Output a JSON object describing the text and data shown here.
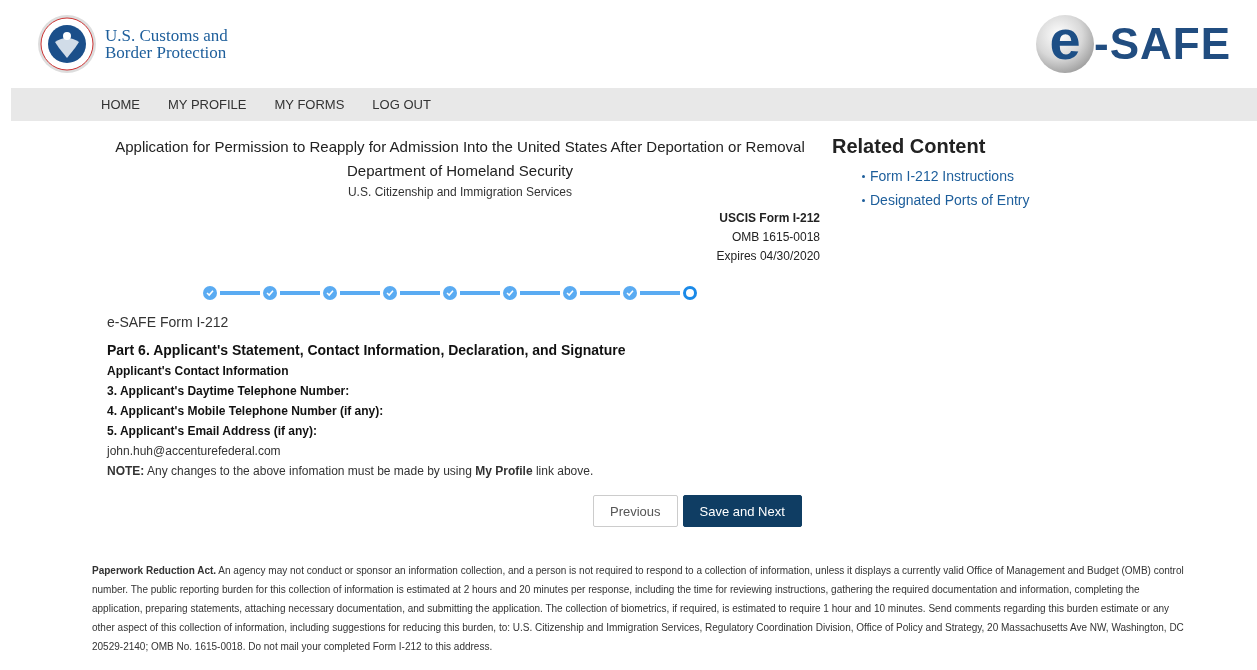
{
  "header": {
    "agency_name": [
      "U.S. Customs and",
      "Border Protection"
    ],
    "brand_logo": {
      "mark": "e",
      "text": "-SAFE"
    }
  },
  "nav": {
    "items": [
      "HOME",
      "MY PROFILE",
      "MY FORMS",
      "LOG OUT"
    ]
  },
  "form_header": {
    "title": "Application for Permission to Reapply for Admission Into the United States After Deportation or Removal",
    "department": "Department of Homeland Security",
    "agency": "U.S. Citizenship and Immigration Services",
    "form_number": "USCIS Form I-212",
    "omb": "OMB 1615-0018",
    "expires": "Expires 04/30/2020"
  },
  "stepper": [
    {
      "completed": true
    },
    {
      "completed": true
    },
    {
      "completed": true
    },
    {
      "completed": true
    },
    {
      "completed": true
    },
    {
      "completed": true
    },
    {
      "completed": true
    },
    {
      "completed": true
    },
    {
      "completed": false
    }
  ],
  "form_label": "e-SAFE Form I-212",
  "section": {
    "title": "Part 6. Applicant's Statement, Contact Information, Declaration, and Signature",
    "subtitle": "Applicant's Contact Information",
    "fields": [
      {
        "label": "3. Applicant's Daytime Telephone Number:"
      },
      {
        "label": "4. Applicant's Mobile Telephone Number (if any):"
      },
      {
        "label": "5. Applicant's Email Address (if any):",
        "value": "john.huh@accenturefederal.com"
      }
    ],
    "note": "**NOTE:** Any changes to the above infomation must be made by using **My Profile** link above."
  },
  "buttons": [
    "Previous",
    "Save and Next"
  ],
  "related_content": {
    "title": "Related Content",
    "links": [
      "Form I-212 Instructions",
      "Designated Ports of Entry"
    ]
  },
  "footer": "**Paperwork Reduction Act.**  An agency may not conduct or sponsor an information collection, and a person is not required to respond to a collection of information, unless it displays a currently valid Office of Management and Budget (OMB) control number.  The public reporting burden for this collection of information is estimated at 2 hours and 20 minutes per response, including the time for reviewing instructions, gathering the required documentation and information, completing the application, preparing statements, attaching necessary documentation, and submitting the application.  The collection of biometrics, if required, is estimated to require 1 hour and 10 minutes.  Send comments regarding this burden estimate or any other aspect of this collection of information, including suggestions for reducing this burden, to:  U.S. Citizenship and Immigration Services, Regulatory Coordination Division, Office of Policy and Strategy, 20 Massachusetts Ave NW, Washington, DC 20529-2140; OMB No. 1615-0018.  Do not mail your completed Form I-212 to this address."
}
